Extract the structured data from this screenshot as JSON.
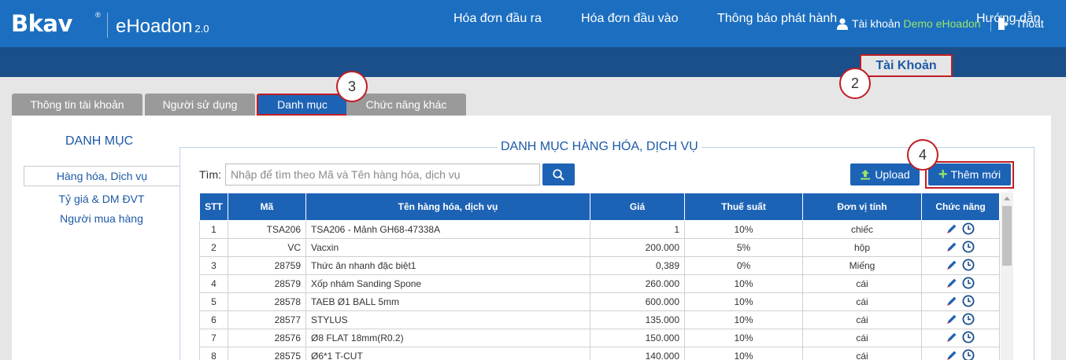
{
  "header": {
    "logo_text": "Bkav",
    "logo_mark": "®",
    "product_name": "eHoadon",
    "product_version": "2.0",
    "account_label": "Tài khoản",
    "account_name": "Demo eHoadon",
    "logout_label": "Thoát"
  },
  "nav": {
    "items": [
      "Hóa đơn đầu ra",
      "Hóa đơn đầu vào",
      "Thông báo phát hành",
      "Tài Khoản",
      "Hướng dẫn"
    ],
    "active_index": 3
  },
  "subtabs": {
    "items": [
      "Thông tin tài khoản",
      "Người sử dụng",
      "Danh mục",
      "Chức năng khác"
    ],
    "active_index": 2
  },
  "callouts": [
    "2",
    "3",
    "4"
  ],
  "sidebar": {
    "title": "DANH MỤC",
    "items": [
      "Hàng hóa, Dịch vụ",
      "Tỷ giá & DM ĐVT",
      "Người mua hàng"
    ],
    "active_index": 0
  },
  "main": {
    "title": "DANH MỤC HÀNG HÓA, DỊCH VỤ",
    "search_label": "Tìm:",
    "search_placeholder": "Nhập để tìm theo Mã và Tên hàng hóa, dịch vụ",
    "upload_label": "Upload",
    "add_label": "Thêm mới",
    "table": {
      "headers": [
        "STT",
        "Mã",
        "Tên hàng hóa, dịch vụ",
        "Giá",
        "Thuế suất",
        "Đơn vị tính",
        "Chức năng"
      ],
      "rows": [
        [
          "1",
          "TSA206",
          "TSA206 - Mảnh GH68-47338A",
          "1",
          "10%",
          "chiếc"
        ],
        [
          "2",
          "VC",
          "Vacxin",
          "200.000",
          "5%",
          "hộp"
        ],
        [
          "3",
          "28759",
          "Thức ăn nhanh đặc biệt1",
          "0,389",
          "0%",
          "Miếng"
        ],
        [
          "4",
          "28579",
          "Xốp nhám Sanding Spone",
          "260.000",
          "10%",
          "cái"
        ],
        [
          "5",
          "28578",
          "TAEB Ø1 BALL 5mm",
          "600.000",
          "10%",
          "cái"
        ],
        [
          "6",
          "28577",
          "STYLUS",
          "135.000",
          "10%",
          "cái"
        ],
        [
          "7",
          "28576",
          "Ø8 FLAT 18mm(R0.2)",
          "150.000",
          "10%",
          "cái"
        ],
        [
          "8",
          "28575",
          "Ø6*1 T-CUT",
          "140.000",
          "10%",
          "cái"
        ]
      ]
    }
  },
  "colors": {
    "header_blue": "#1c6fc0",
    "nav_blue": "#1a4f8a",
    "button_blue": "#1d63b5",
    "highlight_red": "#c01d24",
    "account_green": "#9be36b"
  }
}
